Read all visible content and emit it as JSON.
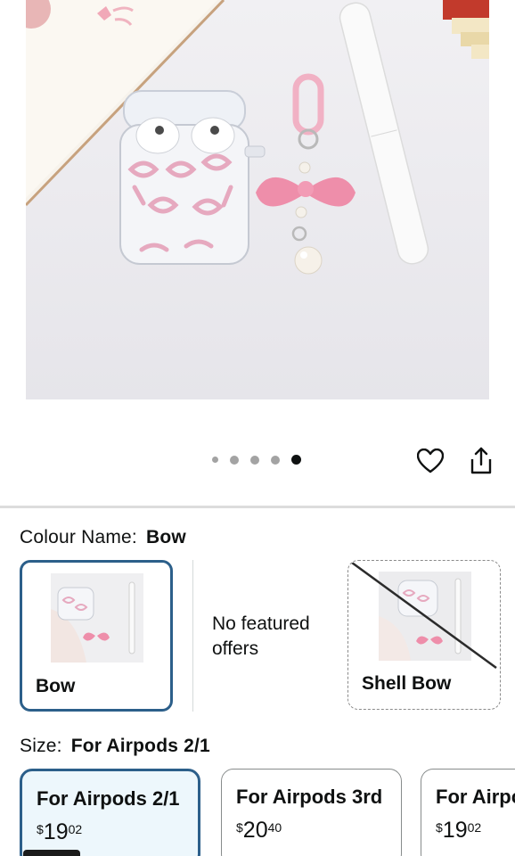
{
  "carousel": {
    "dot_count": 5,
    "active_index": 4
  },
  "actions": {
    "wishlist_icon": "heart-icon",
    "share_icon": "share-icon"
  },
  "colour": {
    "label": "Colour Name:",
    "selected": "Bow",
    "options": [
      {
        "name": "Bow",
        "state": "selected"
      },
      {
        "name": "No featured offers",
        "state": "no-offers"
      },
      {
        "name": "Shell Bow",
        "state": "unavailable"
      }
    ]
  },
  "size": {
    "label": "Size:",
    "selected": "For Airpods 2/1",
    "options": [
      {
        "title": "For Airpods 2/1",
        "currency": "$",
        "whole": "19",
        "fraction": "02",
        "state": "selected"
      },
      {
        "title": "For Airpods 3rd",
        "currency": "$",
        "whole": "20",
        "fraction": "40",
        "state": "default"
      },
      {
        "title": "For Airpods Pro",
        "currency": "$",
        "whole": "19",
        "fraction": "02",
        "state": "default"
      }
    ]
  },
  "colors": {
    "selected_border": "#2c5f8a",
    "selected_fill": "#edf7fc",
    "accent_pink": "#e8a3b8"
  }
}
